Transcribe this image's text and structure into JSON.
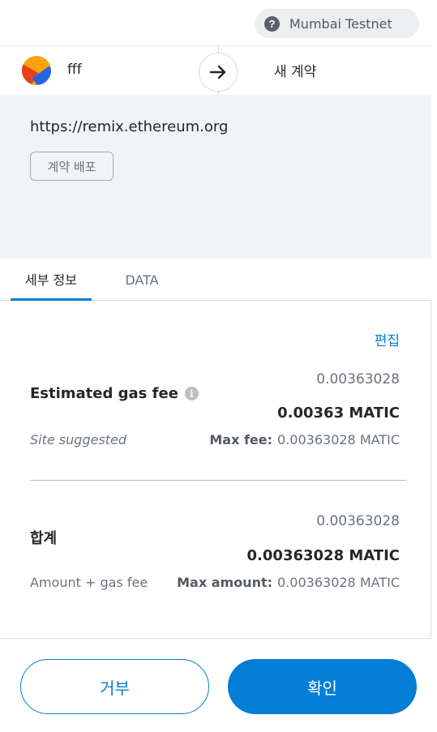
{
  "header": {
    "network_label": "Mumbai Testnet",
    "network_icon": "question-icon"
  },
  "account": {
    "name": "fff",
    "arrow_icon": "arrow-right-icon",
    "recipient_label": "새 계약"
  },
  "origin": {
    "url": "https://remix.ethereum.org",
    "action_tag": "계약 배포"
  },
  "tabs": [
    {
      "label": "세부 정보",
      "active": true
    },
    {
      "label": "DATA",
      "active": false
    }
  ],
  "details": {
    "edit_label": "편집",
    "gas": {
      "title": "Estimated gas fee",
      "secondary_value": "0.00363028",
      "primary_value": "0.00363 MATIC",
      "sub_left": "Site suggested",
      "max_label": "Max fee:",
      "max_value": "0.00363028 MATIC"
    },
    "total": {
      "title": "합계",
      "secondary_value": "0.00363028",
      "primary_value": "0.00363028 MATIC",
      "sub_left": "Amount + gas fee",
      "max_label": "Max amount:",
      "max_value": "0.00363028 MATIC"
    }
  },
  "footer": {
    "reject_label": "거부",
    "confirm_label": "확인"
  },
  "colors": {
    "accent": "#037dd6",
    "panel_bg": "#f2f3f4"
  }
}
